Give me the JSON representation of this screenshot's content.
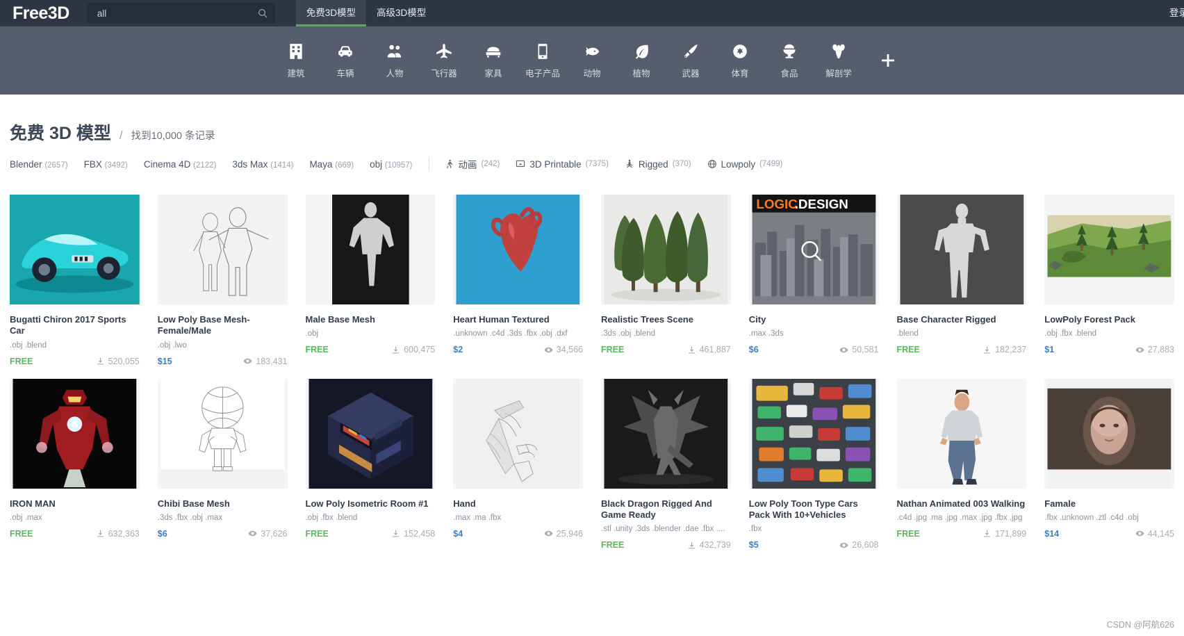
{
  "header": {
    "logo": "Free3D",
    "search": {
      "value": "all",
      "placeholder": "all",
      "icon": "search-icon"
    },
    "tabs": [
      {
        "label": "免费3D模型",
        "active": true
      },
      {
        "label": "高级3D模型",
        "active": false
      }
    ],
    "login_label": "登录"
  },
  "categories": [
    {
      "label": "建筑",
      "icon": "building-icon"
    },
    {
      "label": "车辆",
      "icon": "car-icon"
    },
    {
      "label": "人物",
      "icon": "people-icon"
    },
    {
      "label": "飞行器",
      "icon": "airplane-icon"
    },
    {
      "label": "家具",
      "icon": "furniture-icon"
    },
    {
      "label": "电子产品",
      "icon": "phone-icon"
    },
    {
      "label": "动物",
      "icon": "fish-icon"
    },
    {
      "label": "植物",
      "icon": "leaf-icon"
    },
    {
      "label": "武器",
      "icon": "knife-icon"
    },
    {
      "label": "体育",
      "icon": "ball-icon"
    },
    {
      "label": "食品",
      "icon": "food-icon"
    },
    {
      "label": "解剖学",
      "icon": "anatomy-icon"
    }
  ],
  "category_more_icon": "plus-icon",
  "page": {
    "title": "免费 3D 模型",
    "separator": "/",
    "count_text": "找到10,000 条记录"
  },
  "filters": {
    "formats": [
      {
        "label": "Blender",
        "count": "(2657)"
      },
      {
        "label": "FBX",
        "count": "(3492)"
      },
      {
        "label": "Cinema 4D",
        "count": "(2122)"
      },
      {
        "label": "3ds Max",
        "count": "(1414)"
      },
      {
        "label": "Maya",
        "count": "(669)"
      },
      {
        "label": "obj",
        "count": "(10957)"
      }
    ],
    "features": [
      {
        "label": "动画",
        "count": "(242)",
        "icon": "running-icon"
      },
      {
        "label": "3D Printable",
        "count": "(7375)",
        "icon": "printer-icon"
      },
      {
        "label": "Rigged",
        "count": "(370)",
        "icon": "rig-icon"
      },
      {
        "label": "Lowpoly",
        "count": "(7499)",
        "icon": "globe-icon"
      }
    ]
  },
  "cards": [
    {
      "name": "Bugatti Chiron 2017 Sports Car",
      "formats": ".obj .blend",
      "price": "FREE",
      "free": true,
      "stat": "520,055",
      "stat_icon": "download-icon",
      "thumb": "bugatti"
    },
    {
      "name": "Low Poly Base Mesh-Female/Male",
      "formats": ".obj .lwo",
      "price": "$15",
      "free": false,
      "stat": "183,431",
      "stat_icon": "eye-icon",
      "thumb": "basemesh-pair"
    },
    {
      "name": "Male Base Mesh",
      "formats": ".obj",
      "price": "FREE",
      "free": true,
      "stat": "600,475",
      "stat_icon": "download-icon",
      "thumb": "male-base"
    },
    {
      "name": "Heart Human Textured",
      "formats": ".unknown .c4d .3ds .fbx .obj .dxf",
      "price": "$2",
      "free": false,
      "stat": "34,566",
      "stat_icon": "eye-icon",
      "thumb": "heart"
    },
    {
      "name": "Realistic Trees Scene",
      "formats": ".3ds .obj .blend",
      "price": "FREE",
      "free": true,
      "stat": "461,887",
      "stat_icon": "download-icon",
      "thumb": "trees"
    },
    {
      "name": "City",
      "formats": ".max .3ds",
      "price": "$6",
      "free": false,
      "stat": "50,581",
      "stat_icon": "eye-icon",
      "thumb": "city"
    },
    {
      "name": "Base Character Rigged",
      "formats": ".blend",
      "price": "FREE",
      "free": true,
      "stat": "182,237",
      "stat_icon": "download-icon",
      "thumb": "base-char"
    },
    {
      "name": "LowPoly Forest Pack",
      "formats": ".obj .fbx .blend",
      "price": "$1",
      "free": false,
      "stat": "27,883",
      "stat_icon": "eye-icon",
      "thumb": "forest"
    },
    {
      "name": "IRON MAN",
      "formats": ".obj .max",
      "price": "FREE",
      "free": true,
      "stat": "632,363",
      "stat_icon": "download-icon",
      "thumb": "ironman"
    },
    {
      "name": "Chibi Base Mesh",
      "formats": ".3ds .fbx .obj .max",
      "price": "$6",
      "free": false,
      "stat": "37,626",
      "stat_icon": "eye-icon",
      "thumb": "chibi"
    },
    {
      "name": "Low Poly Isometric Room #1",
      "formats": ".obj .fbx .blend",
      "price": "FREE",
      "free": true,
      "stat": "152,458",
      "stat_icon": "download-icon",
      "thumb": "isoroom"
    },
    {
      "name": "Hand",
      "formats": ".max .ma .fbx",
      "price": "$4",
      "free": false,
      "stat": "25,946",
      "stat_icon": "eye-icon",
      "thumb": "hand"
    },
    {
      "name": "Black Dragon Rigged And Game Ready",
      "formats": ".stl .unity .3ds .blender .dae .fbx ....",
      "price": "FREE",
      "free": true,
      "stat": "432,739",
      "stat_icon": "download-icon",
      "thumb": "dragon"
    },
    {
      "name": "Low Poly Toon Type Cars Pack With 10+Vehicles",
      "formats": ".fbx",
      "price": "$5",
      "free": false,
      "stat": "26,608",
      "stat_icon": "eye-icon",
      "thumb": "cars"
    },
    {
      "name": "Nathan Animated 003 Walking",
      "formats": ".c4d .jpg .ma .jpg .max .jpg .fbx .jpg",
      "price": "FREE",
      "free": true,
      "stat": "171,899",
      "stat_icon": "download-icon",
      "thumb": "nathan"
    },
    {
      "name": "Famale",
      "formats": ".fbx .unknown .ztl .c4d .obj",
      "price": "$14",
      "free": false,
      "stat": "44,145",
      "stat_icon": "eye-icon",
      "thumb": "female"
    }
  ],
  "watermark": "CSDN @阿航626",
  "colors": {
    "topbar": "#2e3643",
    "catbar": "#565e6e",
    "accent_green": "#4caf50",
    "free_green": "#5cb85c",
    "price_blue": "#3a7fc1"
  }
}
